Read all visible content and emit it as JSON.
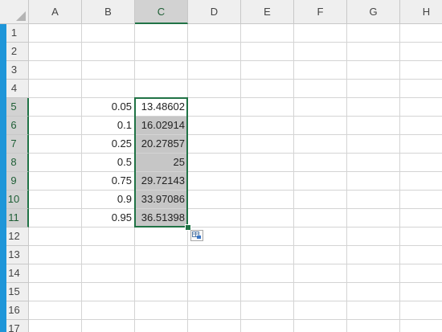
{
  "columns": [
    "A",
    "B",
    "C",
    "D",
    "E",
    "F",
    "G",
    "H"
  ],
  "rows": [
    "1",
    "2",
    "3",
    "4",
    "5",
    "6",
    "7",
    "8",
    "9",
    "10",
    "11",
    "12",
    "13",
    "14",
    "15",
    "16",
    "17"
  ],
  "selection": {
    "active_column": "C",
    "active_rows": [
      "5",
      "6",
      "7",
      "8",
      "9",
      "10",
      "11"
    ]
  },
  "cells": {
    "B5": "0.05",
    "C5": "13.48602",
    "B6": "0.1",
    "C6": "16.02914",
    "B7": "0.25",
    "C7": "20.27857",
    "B8": "0.5",
    "C8": "25",
    "B9": "0.75",
    "C9": "29.72143",
    "B10": "0.9",
    "C10": "33.97086",
    "B11": "0.95",
    "C11": "36.51398"
  },
  "colors": {
    "selection_border": "#217346",
    "selection_fill": "#c6c6c6",
    "left_strip": "#1e96d9"
  },
  "icons": {
    "quick_analysis": "quick-analysis-icon"
  }
}
